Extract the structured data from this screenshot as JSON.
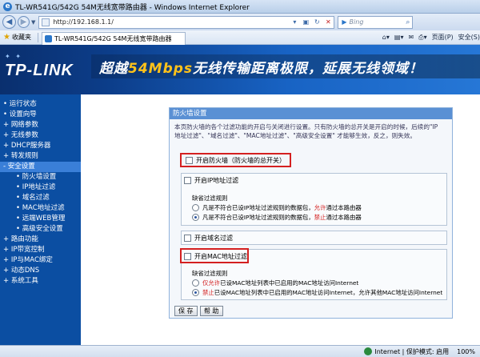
{
  "window": {
    "title": "TL-WR541G/542G 54M无线宽带路由器 - Windows Internet Explorer"
  },
  "address": {
    "url": "http://192.168.1.1/",
    "search_placeholder": "Bing"
  },
  "favorites": {
    "label": "收藏夹",
    "tab_title": "TL-WR541G/542G 54M无线宽带路由器",
    "page_menu": "页面(P)",
    "safety_menu": "安全(S)"
  },
  "banner": {
    "logo": "TP-LINK",
    "slogan_pre": "超越",
    "slogan_hl": "54Mbps",
    "slogan_post": "无线传输距离极限，延展无线领域！"
  },
  "sidebar": {
    "items": [
      {
        "label": "• 运行状态"
      },
      {
        "label": "• 设置向导"
      },
      {
        "label": "+ 网络参数"
      },
      {
        "label": "+ 无线参数"
      },
      {
        "label": "+ DHCP服务器"
      },
      {
        "label": "+ 转发规则"
      },
      {
        "label": "- 安全设置"
      },
      {
        "label": "• 防火墙设置"
      },
      {
        "label": "• IP地址过滤"
      },
      {
        "label": "• 域名过滤"
      },
      {
        "label": "• MAC地址过滤"
      },
      {
        "label": "• 远端WEB管理"
      },
      {
        "label": "• 高级安全设置"
      },
      {
        "label": "+ 路由功能"
      },
      {
        "label": "+ IP带宽控制"
      },
      {
        "label": "+ IP与MAC绑定"
      },
      {
        "label": "+ 动态DNS"
      },
      {
        "label": "+ 系统工具"
      }
    ]
  },
  "firewall": {
    "heading": "防火墙设置",
    "desc1": "本页防火墙的各个过滤功能的开启与关闭进行设置。只有防火墙的总开关是开启的时候，后续的\"IP",
    "desc2": "地址过滤\"、\"域名过滤\"、\"MAC地址过滤\"、\"高级安全设置\" 才能够生效，反之，则失效。",
    "enable_firewall": "开启防火墙（防火墙的总开关）",
    "enable_ip": "开启IP地址过滤",
    "ip_default_title": "缺省过滤规则",
    "ip_rule1_pre": "凡是不符合已设IP地址过滤规则的数据包，",
    "ip_rule1_red": "允许",
    "ip_rule1_post": "通过本路由器",
    "ip_rule2_pre": "凡是不符合已设IP地址过滤规则的数据包，",
    "ip_rule2_red": "禁止",
    "ip_rule2_post": "通过本路由器",
    "enable_domain": "开启域名过滤",
    "enable_mac": "开启MAC地址过滤",
    "mac_default_title": "缺省过滤规则",
    "mac_rule1_red": "仅允许",
    "mac_rule1_post": "已设MAC地址列表中已启用的MAC地址访问Internet",
    "mac_rule2_red": "禁止",
    "mac_rule2_post": "已设MAC地址列表中已启用的MAC地址访问Internet，允许其他MAC地址访问Internet",
    "save": "保 存",
    "help": "帮 助"
  },
  "status": {
    "zone": "Internet | 保护模式: 启用",
    "zoom": "100%"
  }
}
